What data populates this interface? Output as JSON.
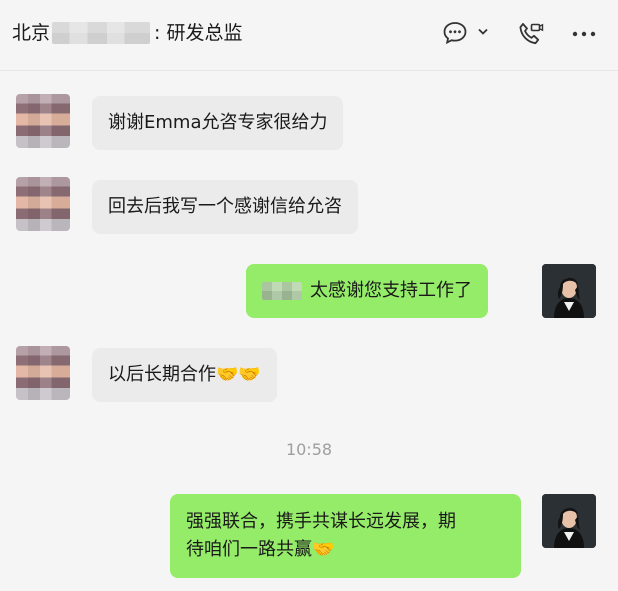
{
  "chat": {
    "title_prefix": "北京",
    "title_suffix": ": 研发总监"
  },
  "messages": [
    {
      "side": "left",
      "text": "谢谢Emma允咨专家很给力"
    },
    {
      "side": "left",
      "text": "回去后我写一个感谢信给允咨"
    },
    {
      "side": "right",
      "text": "太感谢您支持工作了"
    },
    {
      "side": "left",
      "text": "以后长期合作🤝🤝"
    },
    {
      "side": "right",
      "text_line1": "强强联合，携手共谋长远发展，期",
      "text_line2": "待咱们一路共赢🤝"
    }
  ],
  "timestamp": "10:58",
  "icons": {
    "chat": "chat-bubble-icon",
    "dropdown": "chevron-down-icon",
    "call": "phone-video-icon",
    "more": "more-icon"
  },
  "colors": {
    "left_bubble": "#ebebeb",
    "right_bubble": "#95ec69",
    "background": "#f5f5f5"
  }
}
